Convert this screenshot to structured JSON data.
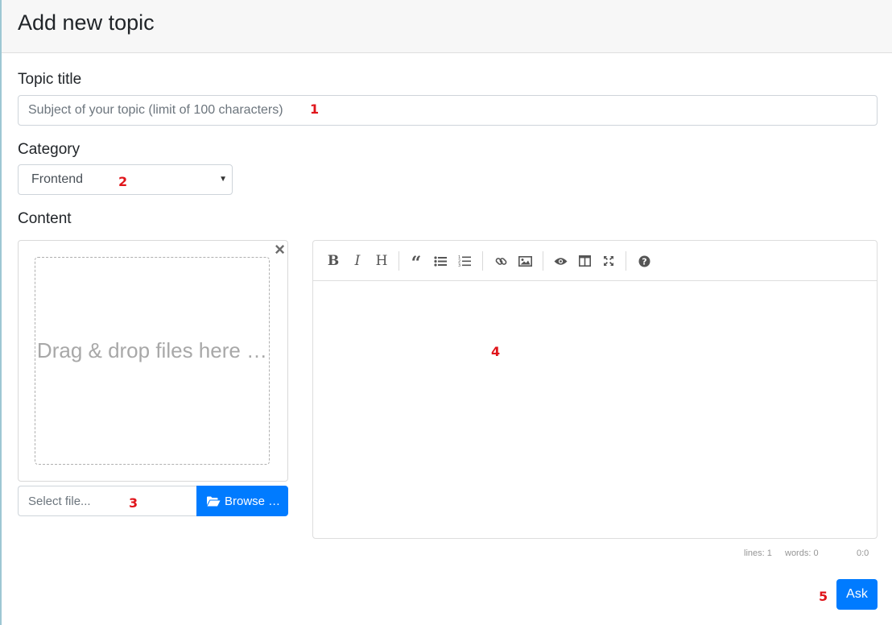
{
  "header": {
    "title": "Add new topic"
  },
  "topic": {
    "label": "Topic title",
    "placeholder": "Subject of your topic (limit of 100 characters)",
    "marker": "1"
  },
  "category": {
    "label": "Category",
    "selected": "Frontend",
    "marker": "2"
  },
  "content": {
    "label": "Content",
    "dropzone_text": "Drag & drop files here …",
    "file_placeholder": "Select file...",
    "browse_label": "Browse …",
    "file_marker": "3",
    "editor_marker": "4"
  },
  "toolbar": {
    "items": [
      "bold-icon",
      "italic-icon",
      "heading-icon",
      "quote-icon",
      "unordered-list-icon",
      "ordered-list-icon",
      "link-icon",
      "image-icon",
      "preview-icon",
      "side-by-side-icon",
      "fullscreen-icon",
      "help-icon"
    ]
  },
  "status": {
    "lines": "lines: 1",
    "words": "words: 0",
    "cursor": "0:0"
  },
  "actions": {
    "ask_label": "Ask",
    "ask_marker": "5"
  },
  "colors": {
    "primary": "#007bff",
    "marker": "#e0151b"
  }
}
